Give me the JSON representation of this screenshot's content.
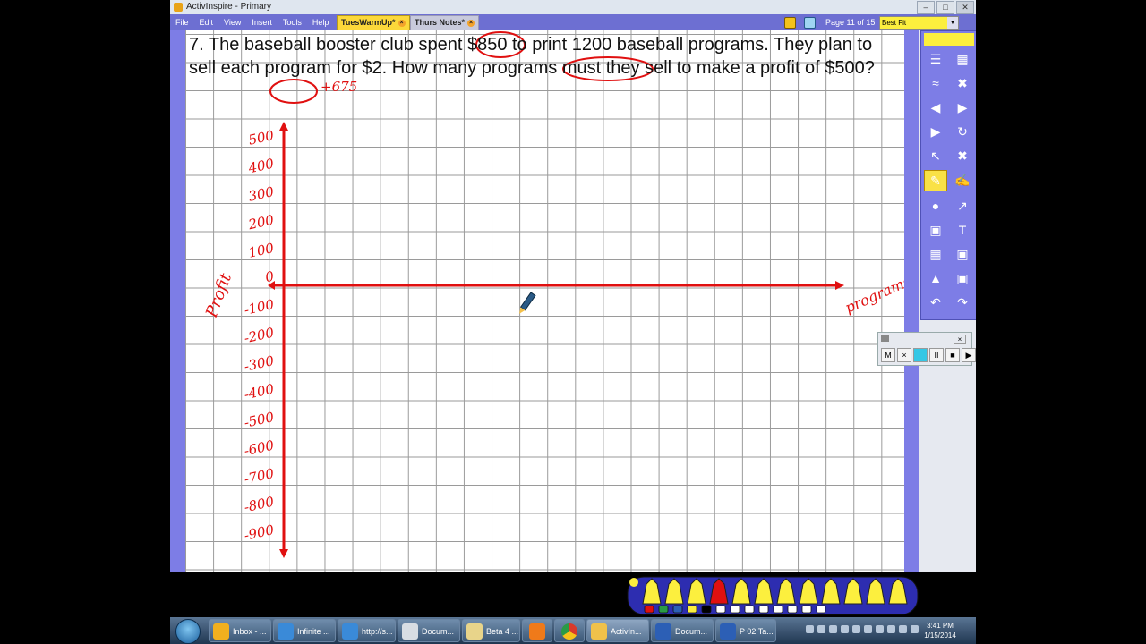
{
  "window": {
    "title": "ActivInspire - Primary"
  },
  "menu": [
    "File",
    "Edit",
    "View",
    "Insert",
    "Tools",
    "Help"
  ],
  "doc_tabs": [
    {
      "label": "TuesWarmUp*",
      "active": true
    },
    {
      "label": "Thurs Notes*",
      "active": false
    }
  ],
  "page_info": "Page 11 of 15",
  "zoom": "Best Fit",
  "question": "7. The baseball booster club spent $850 to print 1200 baseball programs. They plan to sell each program for $2. How many programs must they sell to make a profit of $500?",
  "annotations": {
    "side_note": "+675",
    "y_axis_label": "Profit",
    "x_axis_label": "programs",
    "y_ticks": [
      "500",
      "400",
      "300",
      "200",
      "100",
      "0",
      "-100",
      "-200",
      "-300",
      "-400",
      "-500",
      "-600",
      "-700",
      "-800",
      "-900"
    ],
    "ink_color": "#e01010"
  },
  "recorder": {
    "buttons": [
      "M",
      "×",
      "●",
      "II",
      "■",
      "▶"
    ]
  },
  "taskbar": {
    "items": [
      "Inbox - ...",
      "Infinite ...",
      "http://s...",
      "Docum...",
      "Beta 4 ...",
      "",
      "",
      "ActivIn...",
      "Docum...",
      "P 02 Ta..."
    ],
    "time": "3:41 PM",
    "date": "1/15/2014"
  }
}
